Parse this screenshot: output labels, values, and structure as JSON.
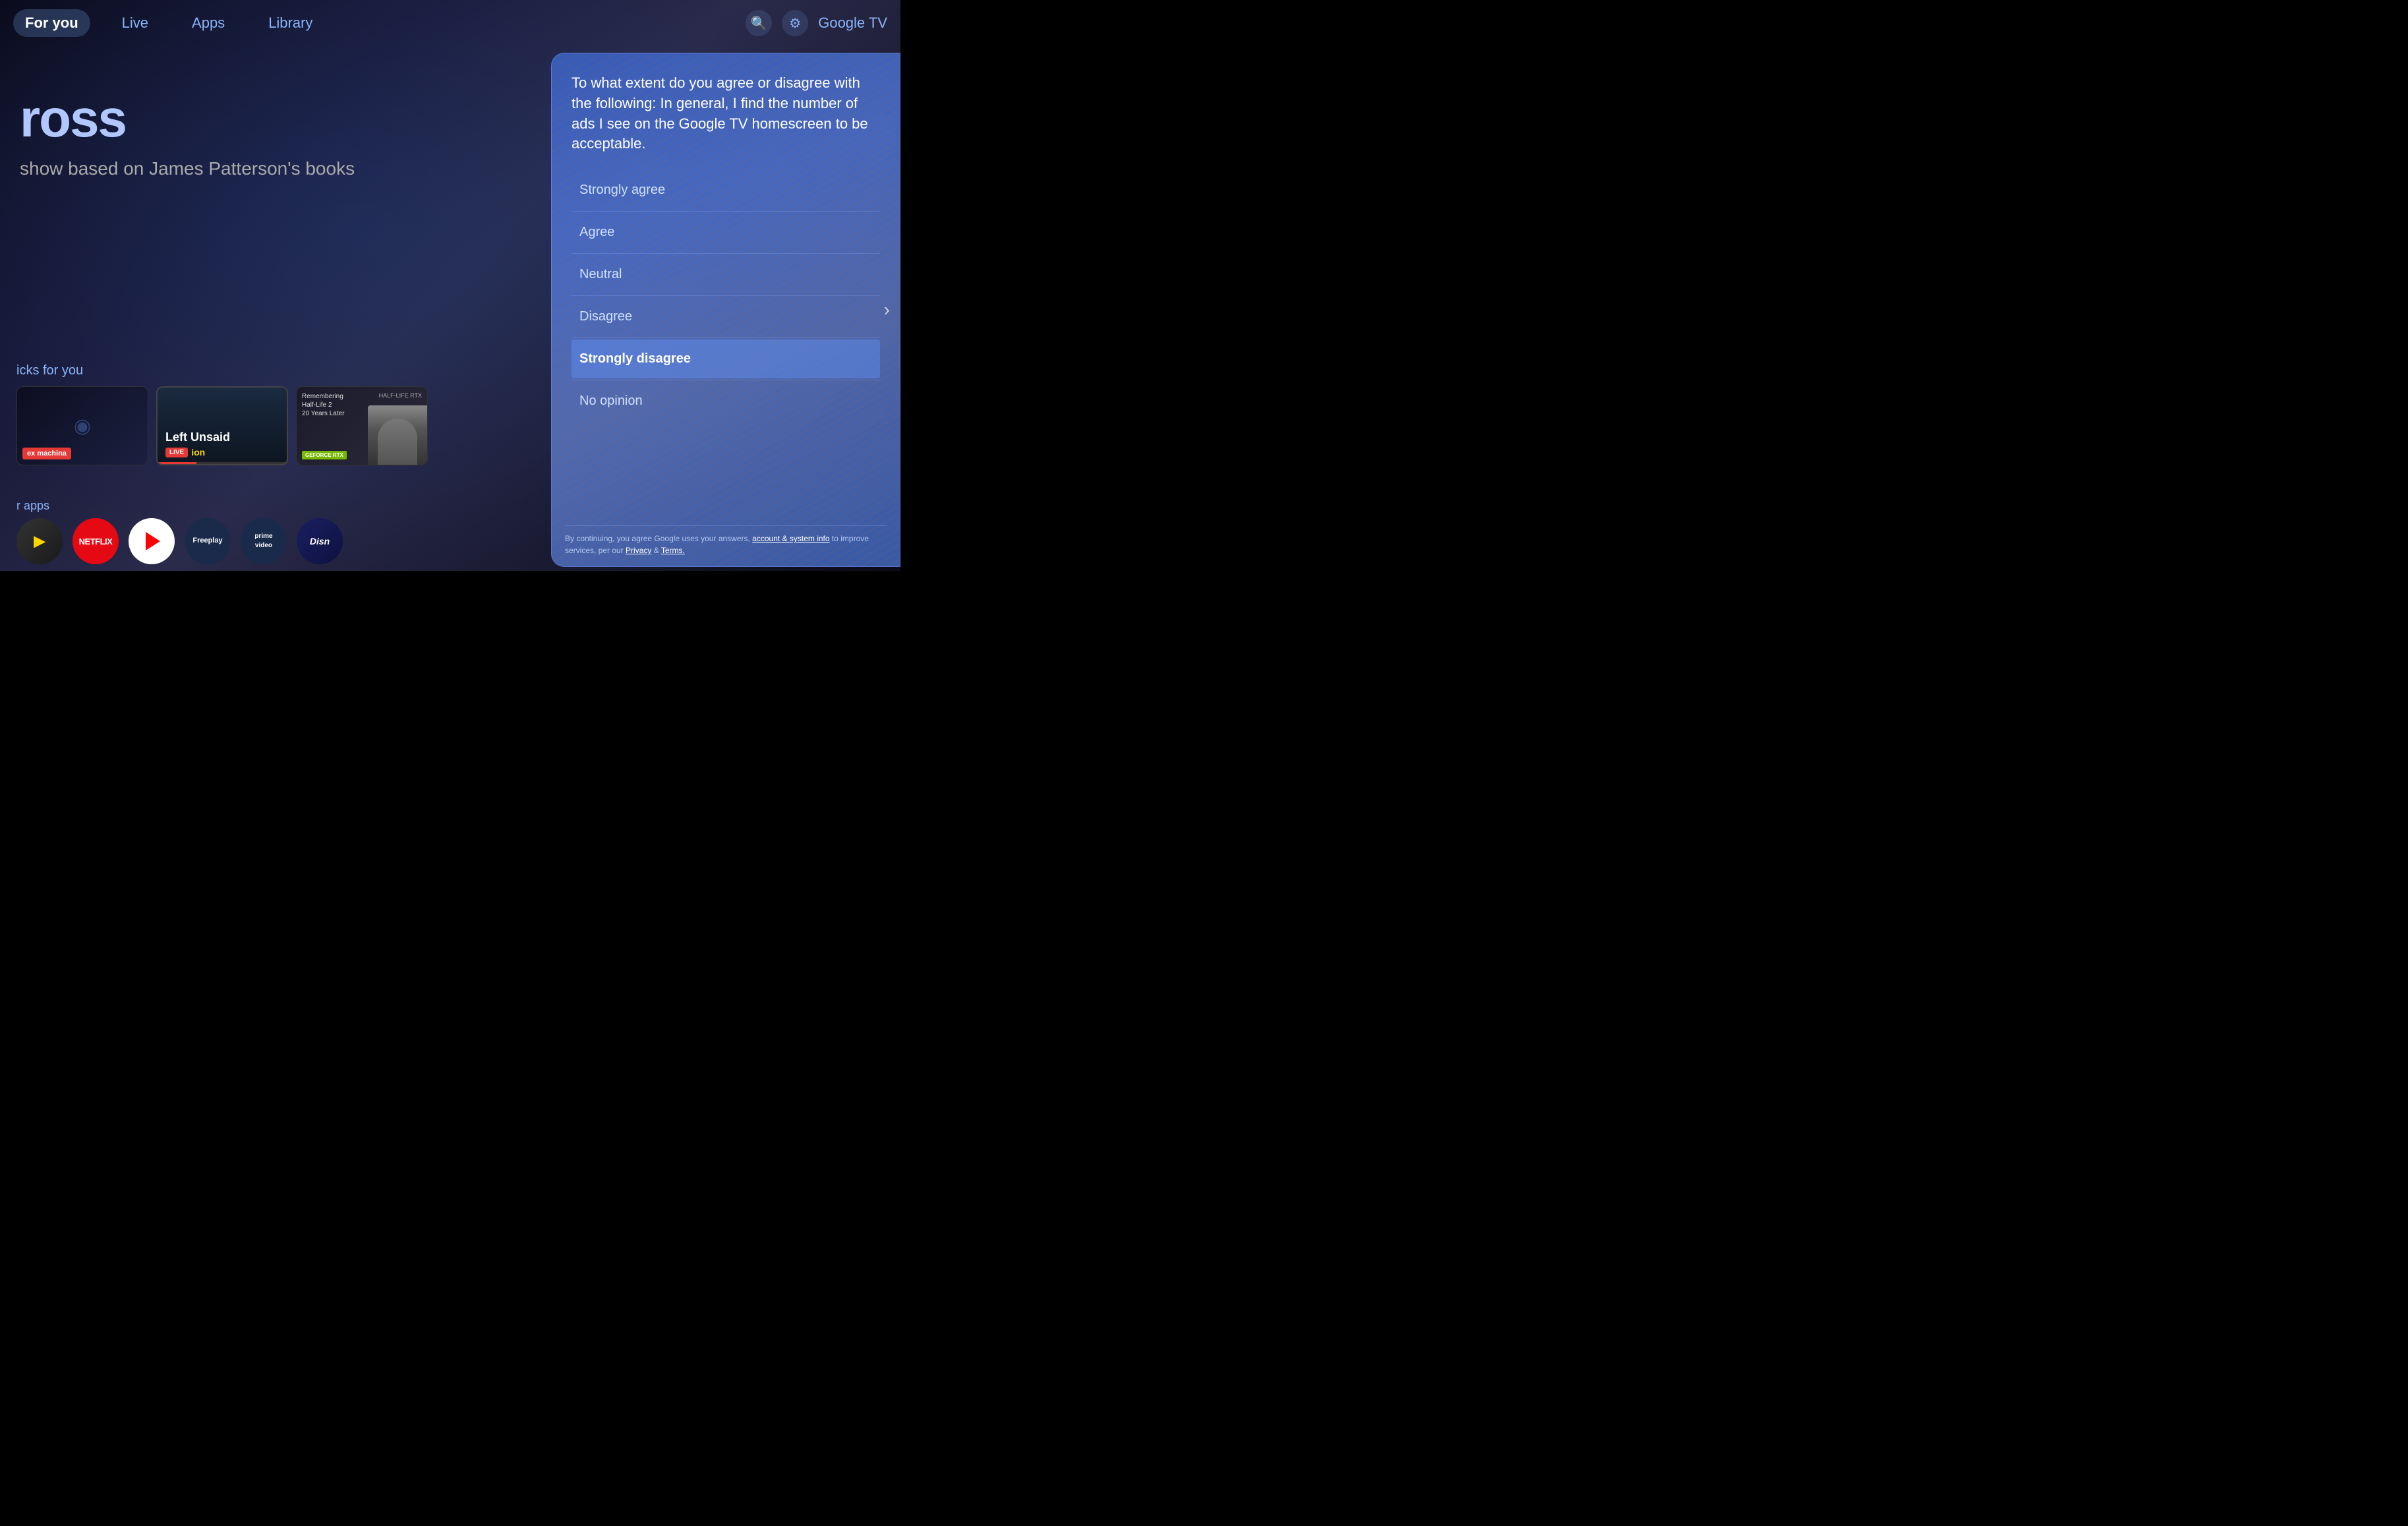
{
  "nav": {
    "items": [
      {
        "label": "For you",
        "active": true
      },
      {
        "label": "Live",
        "active": false
      },
      {
        "label": "Apps",
        "active": false
      },
      {
        "label": "Library",
        "active": false
      }
    ],
    "brand": "Google TV",
    "search_icon": "🔍",
    "settings_icon": "⚙"
  },
  "hero": {
    "title": "ross",
    "subtitle": "show based on James Patterson's books"
  },
  "picks": {
    "label": "icks for you",
    "cards": [
      {
        "id": "ex-machina",
        "badge": "ex machina"
      },
      {
        "id": "left-unsaid",
        "title": "Left Unsaid",
        "live": "LIVE",
        "network": "ion"
      },
      {
        "id": "remembering",
        "top_text": "Remembering\nHalf-Life 2\n20 Years Later",
        "badge": "HALF-LIFE RTX",
        "geforce": "GEFORCE RTX"
      }
    ]
  },
  "apps": {
    "label": "r apps",
    "items": [
      {
        "id": "plex",
        "symbol": "▶"
      },
      {
        "id": "netflix",
        "label": "NETFLIX"
      },
      {
        "id": "youtube",
        "label": "▶"
      },
      {
        "id": "freeplay",
        "label": "Freeplay"
      },
      {
        "id": "prime",
        "label": "prime\nvideo"
      },
      {
        "id": "disney",
        "label": "Disn…"
      }
    ]
  },
  "survey": {
    "question": "To what extent do you agree or disagree with the following: In general, I find the number of ads I see on the Google TV homescreen to be acceptable.",
    "options": [
      {
        "id": "strongly-agree",
        "label": "Strongly agree",
        "selected": false
      },
      {
        "id": "agree",
        "label": "Agree",
        "selected": false
      },
      {
        "id": "neutral",
        "label": "Neutral",
        "selected": false
      },
      {
        "id": "disagree",
        "label": "Disagree",
        "selected": false
      },
      {
        "id": "strongly-disagree",
        "label": "Strongly disagree",
        "selected": true
      },
      {
        "id": "no-opinion",
        "label": "No opinion",
        "selected": false
      }
    ],
    "footer": "By continuing, you agree Google uses your answers, account & system info to improve services, per our Privacy & Terms.",
    "footer_links": [
      "account & system info",
      "Privacy",
      "Terms"
    ]
  }
}
